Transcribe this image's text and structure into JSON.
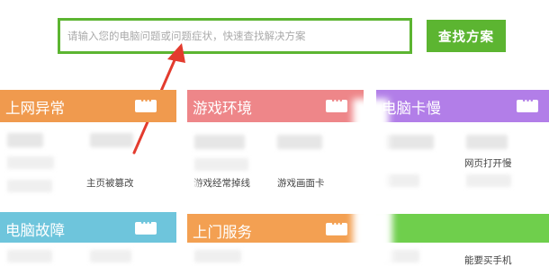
{
  "search": {
    "placeholder": "请输入您的电脑问题或问题症状，快速查找解决方案",
    "button_label": "查找方案"
  },
  "colors": {
    "accent_green": "#5cb531",
    "annotation_red": "#e33b2e",
    "card_orange": "#f09a4e",
    "card_red": "#ee8689",
    "card_purple": "#b27ee8",
    "card_teal": "#6ec5dc",
    "card_green": "#6fcf4c"
  },
  "cards": {
    "internet": {
      "title": "上网异常",
      "items": [
        "主页被篡改"
      ]
    },
    "games": {
      "title": "游戏环境",
      "items": [
        "游戏经常掉线",
        "游戏画面卡"
      ]
    },
    "slow": {
      "title": "电脑卡慢",
      "items": [
        "网页打开慢"
      ]
    },
    "fault": {
      "title": "电脑故障"
    },
    "service": {
      "title": "上门服务"
    },
    "phone": {
      "items": [
        "能要买手机"
      ]
    }
  },
  "icons": [
    "more-icon",
    "arrow-annotation"
  ]
}
